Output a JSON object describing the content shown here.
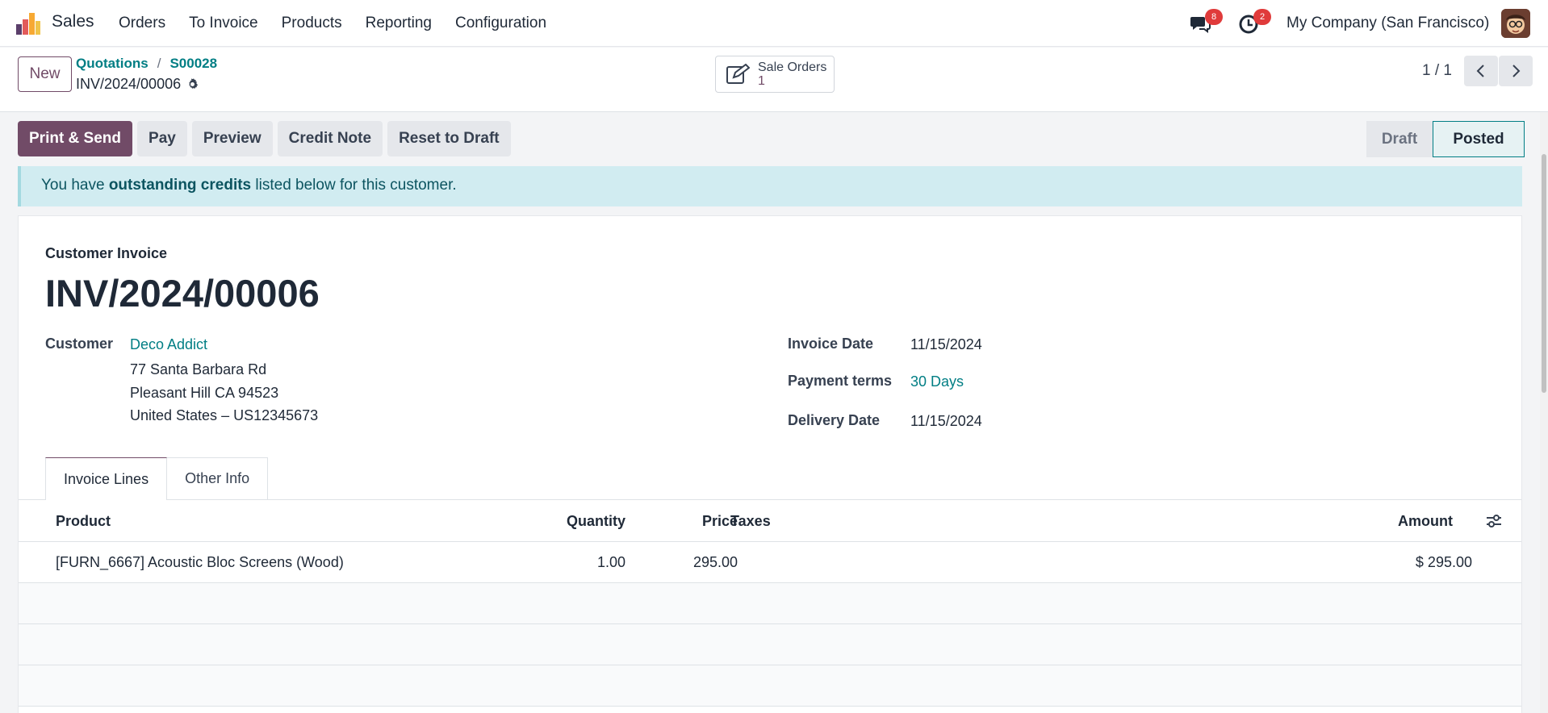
{
  "app": {
    "name": "Sales",
    "menu": [
      "Orders",
      "To Invoice",
      "Products",
      "Reporting",
      "Configuration"
    ]
  },
  "systray": {
    "messages_count": "8",
    "activities_count": "2",
    "company": "My Company (San Francisco)"
  },
  "control": {
    "new_label": "New",
    "breadcrumb": [
      "Quotations",
      "S00028"
    ],
    "record_name": "INV/2024/00006",
    "smart_button": {
      "label": "Sale Orders",
      "count": "1"
    },
    "pager": "1 / 1"
  },
  "actions": [
    "Print & Send",
    "Pay",
    "Preview",
    "Credit Note",
    "Reset to Draft"
  ],
  "status": {
    "draft": "Draft",
    "posted": "Posted"
  },
  "alert": {
    "prefix": "You have ",
    "bold": "outstanding credits",
    "suffix": " listed below for this customer."
  },
  "invoice": {
    "type": "Customer Invoice",
    "number": "INV/2024/00006",
    "customer_label": "Customer",
    "customer_name": "Deco Addict",
    "address": [
      "77 Santa Barbara Rd",
      "Pleasant Hill CA 94523",
      "United States – US12345673"
    ],
    "invoice_date_label": "Invoice Date",
    "invoice_date": "11/15/2024",
    "payment_terms_label": "Payment terms",
    "payment_terms": "30 Days",
    "delivery_date_label": "Delivery Date",
    "delivery_date": "11/15/2024"
  },
  "tabs": [
    "Invoice Lines",
    "Other Info"
  ],
  "lines": {
    "headers": {
      "product": "Product",
      "quantity": "Quantity",
      "price": "Price",
      "taxes": "Taxes",
      "amount": "Amount"
    },
    "rows": [
      {
        "product": "[FURN_6667] Acoustic Bloc Screens (Wood)",
        "quantity": "1.00",
        "price": "295.00",
        "taxes": "",
        "amount": "$ 295.00"
      }
    ]
  },
  "colors": {
    "brand": "#714b67",
    "link": "#017e84",
    "alert_bg": "#d1ecf1"
  }
}
